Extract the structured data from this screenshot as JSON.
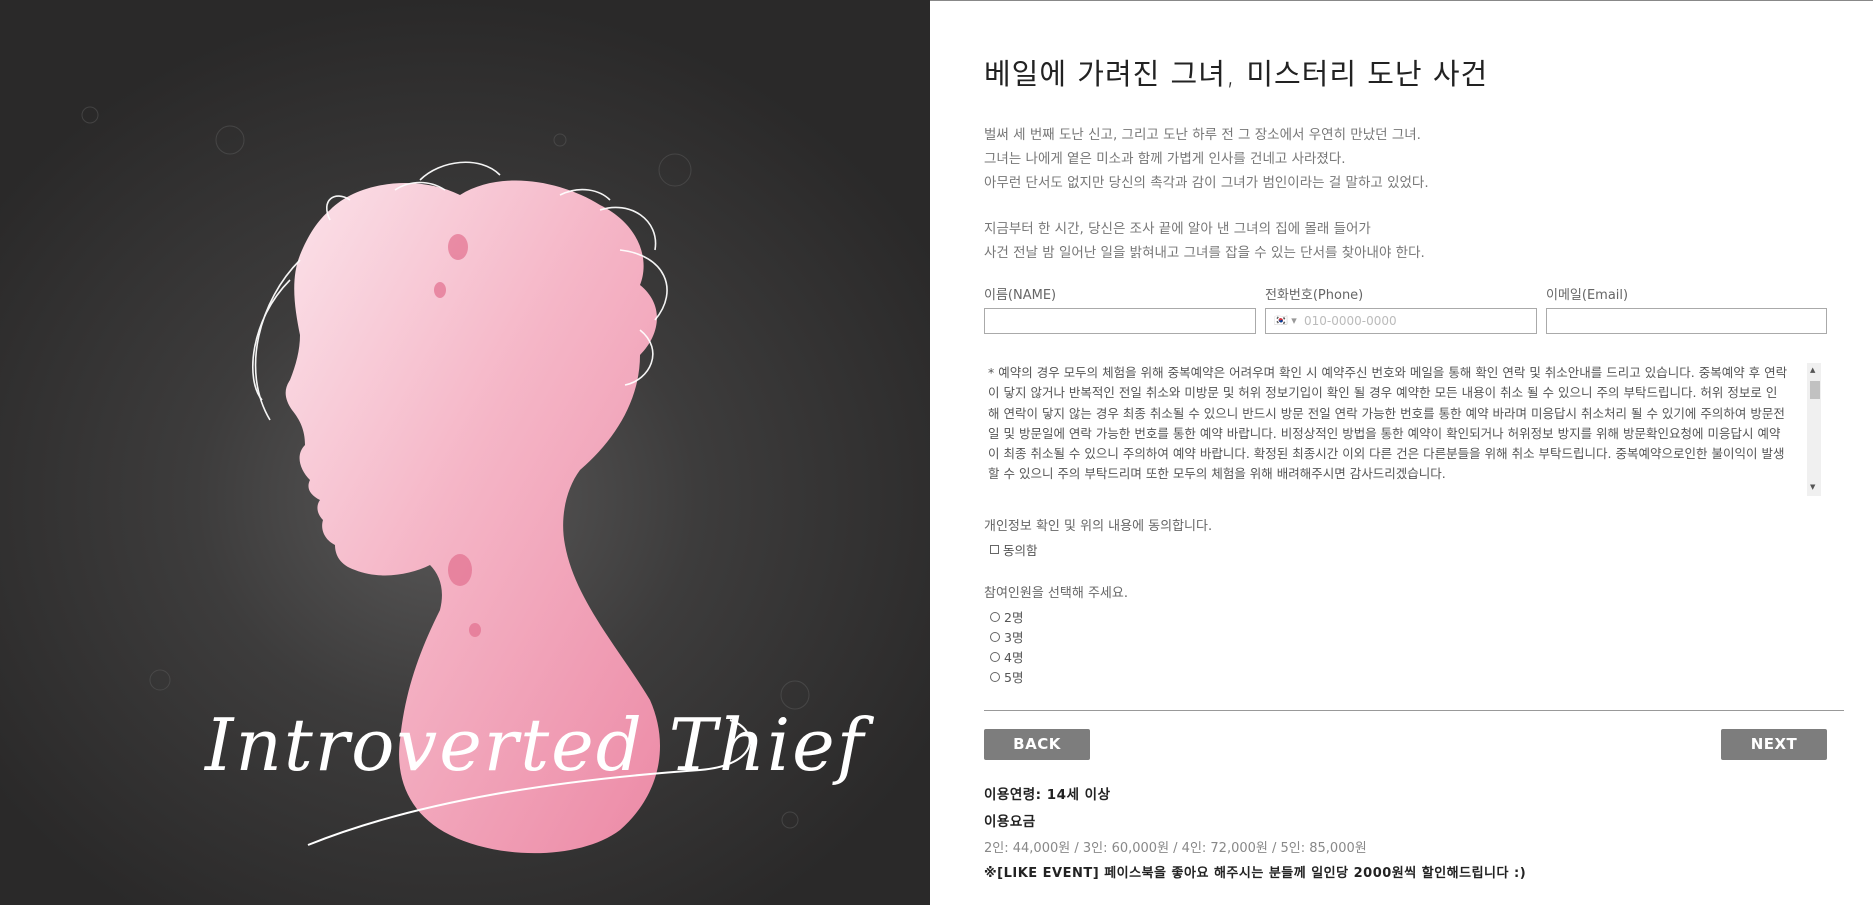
{
  "hero": {
    "script_title": "Introverted Thief"
  },
  "form": {
    "title": "베일에 가려진 그녀, 미스터리 도난 사건",
    "intro_lines": [
      "벌써 세 번째 도난 신고, 그리고 도난 하루 전 그 장소에서 우연히 만났던 그녀.",
      "그녀는 나에게 옅은 미소과 함께 가볍게 인사를 건네고 사라졌다.",
      "아무런 단서도 없지만 당신의 촉각과 감이 그녀가 범인이라는 걸 말하고 있었다."
    ],
    "mission_lines": [
      "지금부터 한 시간, 당신은 조사 끝에 알아 낸 그녀의 집에 몰래 들어가",
      "사건 전날 밤 일어난 일을 밝혀내고 그녀를 잡을 수 있는 단서를 찾아내야 한다."
    ],
    "name_label": "이름(NAME)",
    "phone_label": "전화번호(Phone)",
    "phone_placeholder": "010-0000-0000",
    "phone_country": "🇰🇷",
    "email_label": "이메일(Email)",
    "terms_text": "* 예약의 경우 모두의 체험을 위해 중복예약은 어려우며 확인 시 예약주신 번호와 메일을 통해 확인 연락 및 취소안내를 드리고 있습니다. 중복예약 후 연락이 닿지 않거나 반복적인 전일 취소와 미방문 및 허위 정보기입이 확인 될 경우 예약한 모든 내용이 취소 될 수 있으니 주의 부탁드립니다. 허위 정보로 인해 연락이 닿지 않는 경우 최종 취소될 수 있으니 반드시 방문 전일 연락 가능한 번호를 통한 예약 바라며 미응답시 취소처리 될 수 있기에 주의하여 방문전일 및 방문일에 연락 가능한 번호를 통한 예약 바랍니다. 비정상적인 방법을 통한 예약이 확인되거나 허위정보 방지를 위해 방문확인요청에 미응답시 예약이 최종 취소될 수 있으니 주의하여 예약 바랍니다. 확정된 최종시간 이외 다른 건은 다른분들을 위해 취소 부탁드립니다. 중복예약으로인한 불이익이 발생할 수 있으니 주의 부탁드리며 또한 모두의 체험을 위해 배려해주시면 감사드리겠습니다.",
    "consent_question": "개인정보 확인 및 위의 내용에 동의합니다.",
    "consent_option": "동의함",
    "people_question": "참여인원을 선택해 주세요.",
    "people_options": [
      "2명",
      "3명",
      "4명",
      "5명"
    ],
    "back_label": "BACK",
    "next_label": "NEXT",
    "age_info": "이용연령: 14세 이상",
    "fee_title": "이용요금",
    "fee_text": "2인: 44,000원 / 3인: 60,000원 / 4인: 72,000원 / 5인: 85,000원",
    "event_text": "※[LIKE EVENT] 페이스북을 좋아요 해주시는 분들께 일인당 2000원씩 할인해드립니다 :)"
  },
  "colors": {
    "hero_bg": "#3a3939",
    "silhouette": "#f2a9bd",
    "button": "#7d7d7d"
  }
}
